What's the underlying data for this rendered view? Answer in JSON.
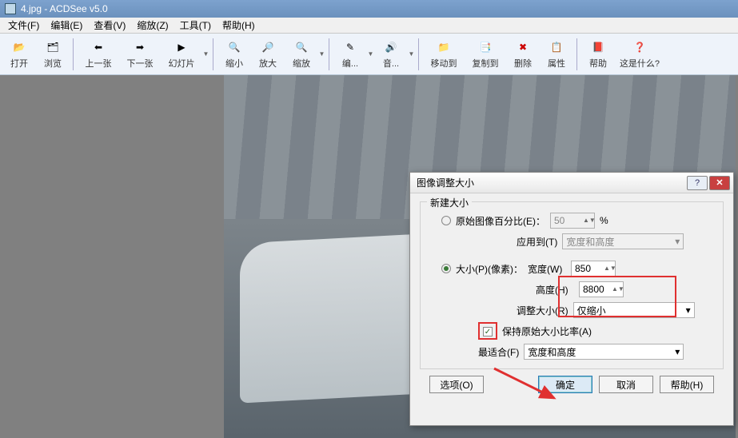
{
  "window": {
    "title": "4.jpg - ACDSee v5.0"
  },
  "menu": {
    "file": "文件(F)",
    "edit": "编辑(E)",
    "view": "查看(V)",
    "zoom": "缩放(Z)",
    "tools": "工具(T)",
    "help": "帮助(H)"
  },
  "toolbar": {
    "open": "打开",
    "browse": "浏览",
    "prev": "上一张",
    "next": "下一张",
    "slideshow": "幻灯片",
    "zoom_out": "缩小",
    "zoom_in": "放大",
    "zoomx": "缩放",
    "editx": "编...",
    "soundx": "音...",
    "move": "移动到",
    "copy": "复制到",
    "delete": "删除",
    "props": "属性",
    "help": "帮助",
    "whatsthis": "这是什么?"
  },
  "dialog": {
    "title": "图像调整大小",
    "group_new_size": "新建大小",
    "radio_percent": "原始图像百分比(E)：",
    "percent_value": "50",
    "percent_unit": "%",
    "apply_to_label": "应用到(T)",
    "apply_to_value": "宽度和高度",
    "radio_size": "大小(P)(像素)：",
    "width_label": "宽度(W)",
    "width_value": "850",
    "height_label": "高度(H)",
    "height_value": "8800",
    "resize_label": "调整大小(R)",
    "resize_value": "仅缩小",
    "keep_ratio": "保持原始大小比率(A)",
    "best_fit_label": "最适合(F)",
    "best_fit_value": "宽度和高度",
    "options_btn": "选项(O)",
    "ok_btn": "确定",
    "cancel_btn": "取消",
    "help_btn": "帮助(H)"
  }
}
